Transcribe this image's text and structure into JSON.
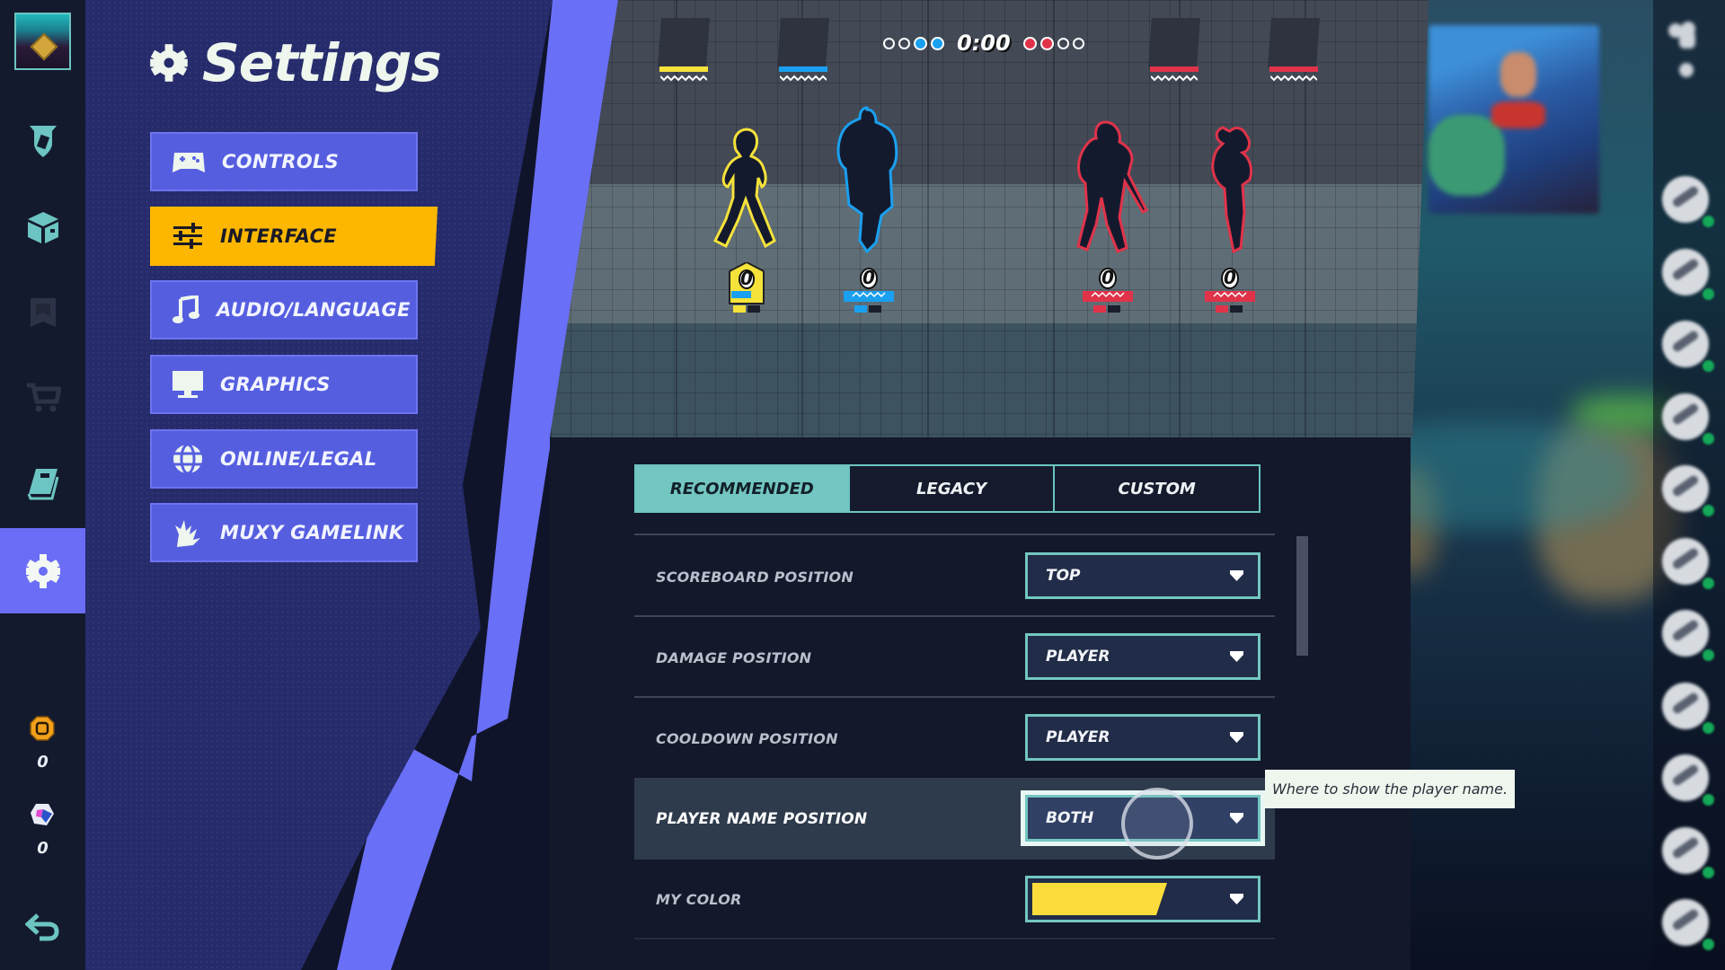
{
  "window": {
    "title": "Settings"
  },
  "sidebar_rail": {
    "items": [
      {
        "name": "profile-avatar",
        "icon": "pendant-avatar-icon"
      },
      {
        "name": "battle-pass",
        "icon": "battlepass-shield-icon"
      },
      {
        "name": "collection",
        "icon": "box-icon"
      },
      {
        "name": "event-disabled",
        "icon": "banner-icon"
      },
      {
        "name": "store",
        "icon": "cart-icon"
      },
      {
        "name": "codex",
        "icon": "book-icon"
      },
      {
        "name": "settings",
        "icon": "gear-icon",
        "active": true
      }
    ],
    "currencies": [
      {
        "name": "gold",
        "icon": "gold-coin-icon",
        "value": "0"
      },
      {
        "name": "gleamium",
        "icon": "gem-icon",
        "value": "0"
      }
    ],
    "back_icon": "back-arrow-icon"
  },
  "settings": {
    "title": "Settings",
    "menu": [
      {
        "id": "controls",
        "label": "CONTROLS",
        "icon": "gamepad-icon"
      },
      {
        "id": "interface",
        "label": "INTERFACE",
        "icon": "sliders-icon",
        "active": true
      },
      {
        "id": "audio",
        "label": "AUDIO/LANGUAGE",
        "icon": "music-note-icon"
      },
      {
        "id": "graphics",
        "label": "GRAPHICS",
        "icon": "monitor-icon"
      },
      {
        "id": "online",
        "label": "ONLINE/LEGAL",
        "icon": "globe-icon"
      },
      {
        "id": "muxy",
        "label": "MUXY GAMELINK",
        "icon": "fox-icon"
      }
    ]
  },
  "preview": {
    "timer": "0:00",
    "blue_stocks": {
      "empty": 2,
      "filled": 2
    },
    "red_stocks": {
      "filled": 2,
      "empty": 2
    },
    "players": [
      {
        "team_color": "#f5e23a",
        "damage": "0",
        "self": true
      },
      {
        "team_color": "#1aa0f0",
        "damage": "0"
      },
      {
        "team_color": "#e0334a",
        "damage": "0"
      },
      {
        "team_color": "#e0334a",
        "damage": "0"
      }
    ]
  },
  "interface": {
    "presets": [
      {
        "label": "RECOMMENDED",
        "active": true
      },
      {
        "label": "LEGACY"
      },
      {
        "label": "CUSTOM"
      }
    ],
    "options": [
      {
        "label": "SCOREBOARD POSITION",
        "value": "TOP"
      },
      {
        "label": "DAMAGE POSITION",
        "value": "PLAYER"
      },
      {
        "label": "COOLDOWN POSITION",
        "value": "PLAYER"
      },
      {
        "label": "PLAYER NAME POSITION",
        "value": "BOTH",
        "focused": true
      },
      {
        "label": "MY COLOR",
        "value": "",
        "swatch": "#fbdc3a"
      }
    ],
    "tooltip": "Where to show the player name."
  },
  "colors": {
    "accent_purple": "#6a6df5",
    "active_tab_yellow": "#fdb700",
    "teal": "#73c6c1",
    "team_yellow": "#f5e23a",
    "team_blue": "#1aa0f0",
    "team_red": "#e0334a"
  },
  "friends": {
    "count_visible": 11,
    "status": "online"
  }
}
